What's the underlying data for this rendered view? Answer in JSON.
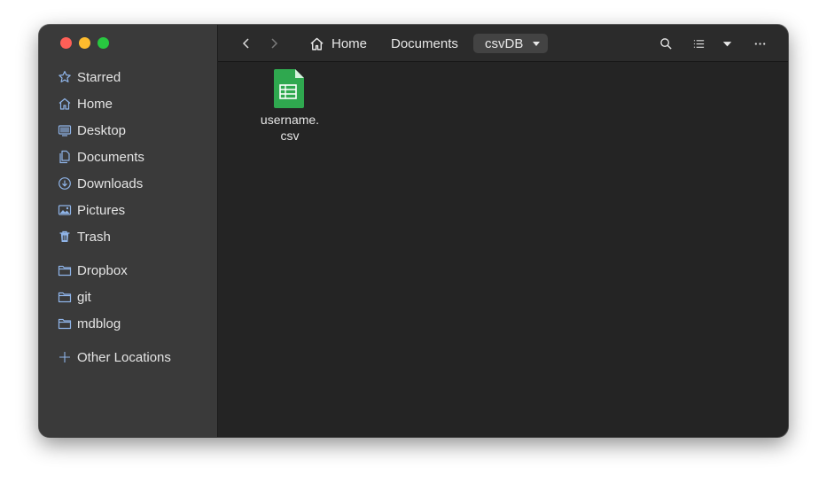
{
  "sidebar": {
    "items": [
      {
        "label": "Starred",
        "icon": "star-icon"
      },
      {
        "label": "Home",
        "icon": "home-icon"
      },
      {
        "label": "Desktop",
        "icon": "desktop-icon"
      },
      {
        "label": "Documents",
        "icon": "documents-icon"
      },
      {
        "label": "Downloads",
        "icon": "download-icon"
      },
      {
        "label": "Pictures",
        "icon": "picture-icon"
      },
      {
        "label": "Trash",
        "icon": "trash-icon"
      }
    ],
    "bookmarks": [
      {
        "label": "Dropbox",
        "icon": "folder-icon"
      },
      {
        "label": "git",
        "icon": "folder-icon"
      },
      {
        "label": "mdblog",
        "icon": "folder-icon"
      }
    ],
    "other_locations": {
      "label": "Other Locations",
      "icon": "plus-icon"
    }
  },
  "toolbar": {
    "breadcrumbs": [
      "Home",
      "Documents",
      "csvDB"
    ]
  },
  "files": [
    {
      "name_line1": "username.",
      "name_line2": "csv",
      "icon": "spreadsheet-file-icon"
    }
  ],
  "colors": {
    "accent_icon": "#8fb4e8",
    "file_green": "#2fa84f"
  }
}
